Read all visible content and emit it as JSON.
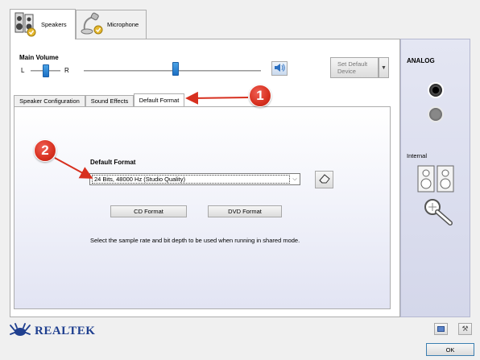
{
  "device_tabs": [
    {
      "label": "Speakers",
      "icon": "speakers-icon",
      "active": true
    },
    {
      "label": "Microphone",
      "icon": "microphone-icon",
      "active": false
    }
  ],
  "volume": {
    "title": "Main Volume",
    "left_label": "L",
    "right_label": "R",
    "balance_level": 0.5,
    "volume_level": 0.5
  },
  "set_default_button": "Set Default Device",
  "inner_tabs": [
    {
      "label": "Speaker Configuration",
      "active": false
    },
    {
      "label": "Sound Effects",
      "active": false
    },
    {
      "label": "Default Format",
      "active": true
    }
  ],
  "format": {
    "heading": "Default Format",
    "selected": "24 Bits, 48000 Hz (Studio Quality)",
    "cd_button": "CD Format",
    "dvd_button": "DVD Format",
    "description": "Select the sample rate and bit depth to be used when running in shared mode."
  },
  "right_panel": {
    "analog_label": "ANALOG",
    "internal_label": "Internal"
  },
  "annotations": [
    {
      "number": "1",
      "color": "#d7301f"
    },
    {
      "number": "2",
      "color": "#d7301f"
    }
  ],
  "brand": "REALTEK",
  "ok_button": "OK",
  "colors": {
    "accent": "#1d70c4",
    "annotation": "#d7301f",
    "brand": "#1f3f8f"
  }
}
